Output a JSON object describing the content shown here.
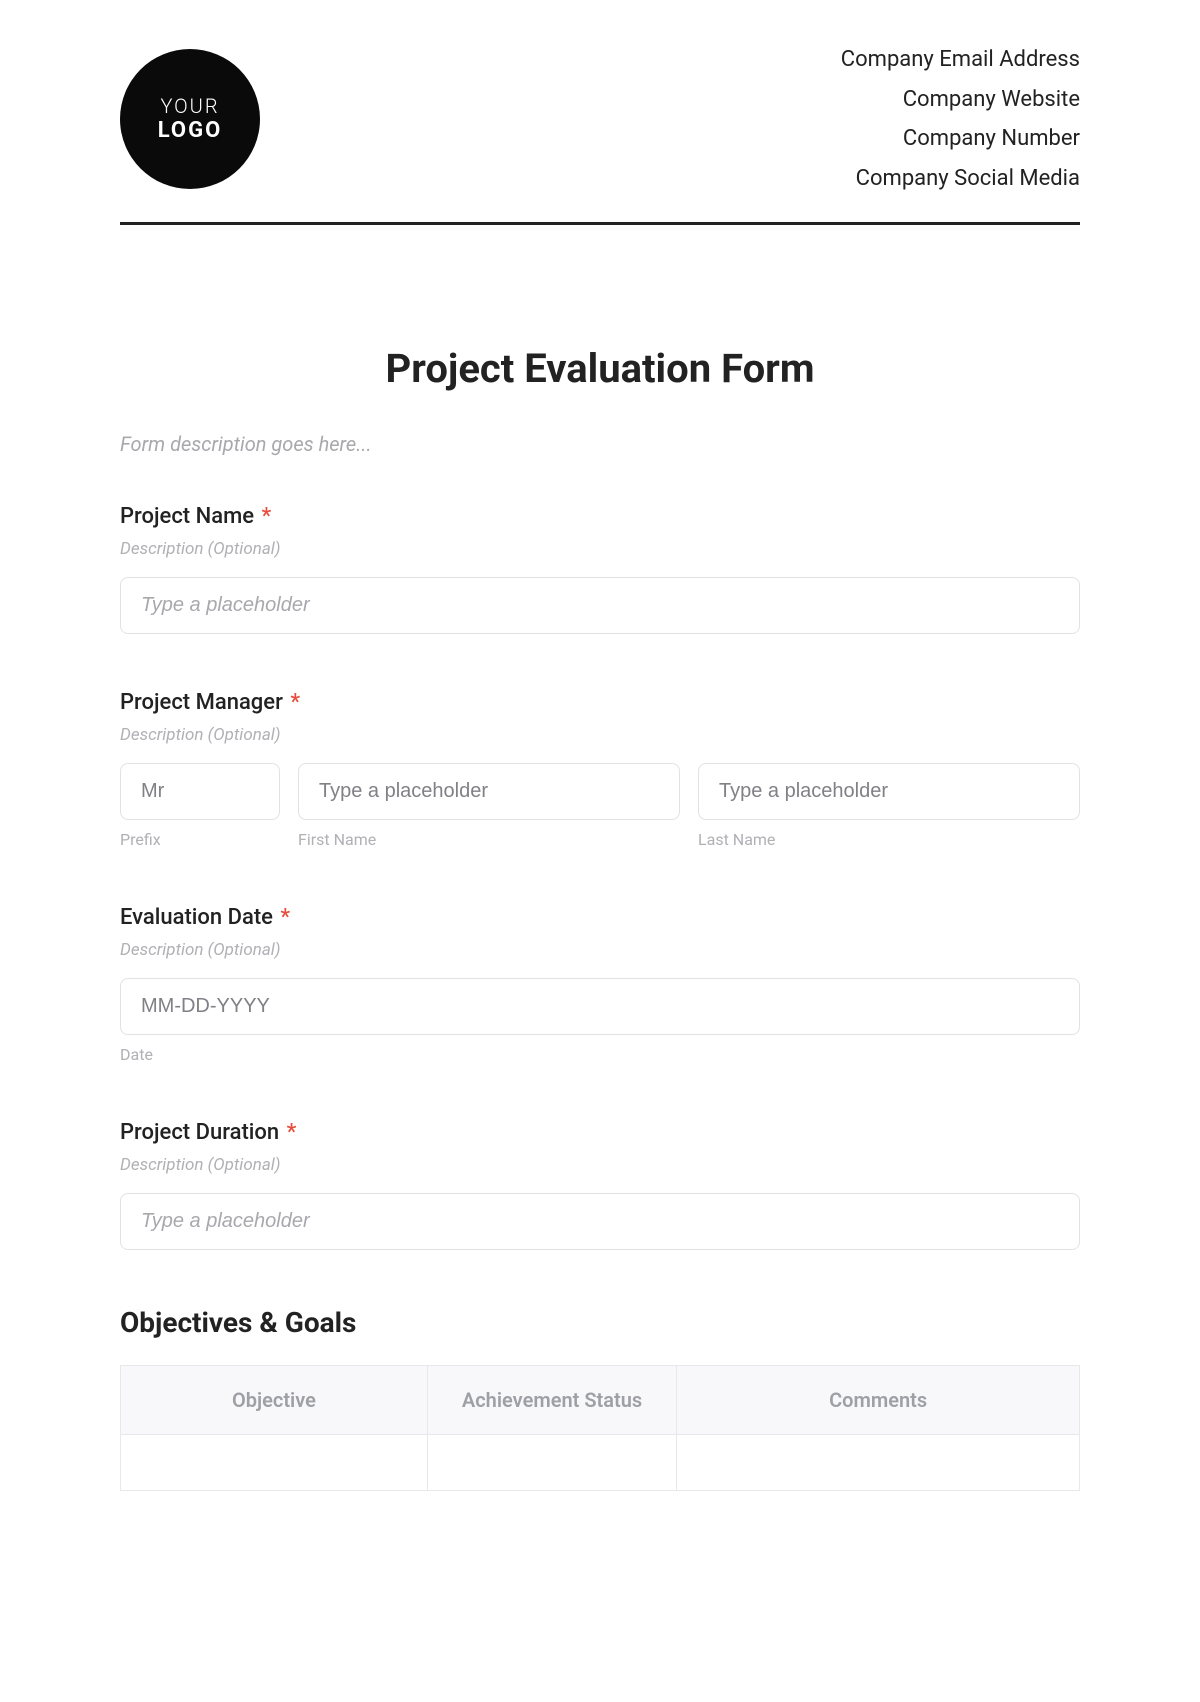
{
  "header": {
    "logo": {
      "line1": "YOUR",
      "line2": "LOGO"
    },
    "company": {
      "email": "Company Email Address",
      "website": "Company Website",
      "number": "Company Number",
      "social": "Company Social Media"
    }
  },
  "title": "Project Evaluation Form",
  "form_description": "Form description goes here...",
  "fields": {
    "project_name": {
      "label": "Project Name",
      "required": "*",
      "desc": "Description (Optional)",
      "placeholder": "Type a placeholder"
    },
    "project_manager": {
      "label": "Project Manager",
      "required": "*",
      "desc": "Description (Optional)",
      "prefix": {
        "value": "Mr",
        "sublabel": "Prefix"
      },
      "first": {
        "placeholder": "Type a placeholder",
        "sublabel": "First Name"
      },
      "last": {
        "placeholder": "Type a placeholder",
        "sublabel": "Last Name"
      }
    },
    "evaluation_date": {
      "label": "Evaluation Date",
      "required": "*",
      "desc": "Description (Optional)",
      "placeholder": "MM-DD-YYYY",
      "sublabel": "Date"
    },
    "project_duration": {
      "label": "Project Duration",
      "required": "*",
      "desc": "Description (Optional)",
      "placeholder": "Type a placeholder"
    }
  },
  "objectives": {
    "heading": "Objectives & Goals",
    "columns": [
      "Objective",
      "Achievement Status",
      "Comments"
    ]
  }
}
